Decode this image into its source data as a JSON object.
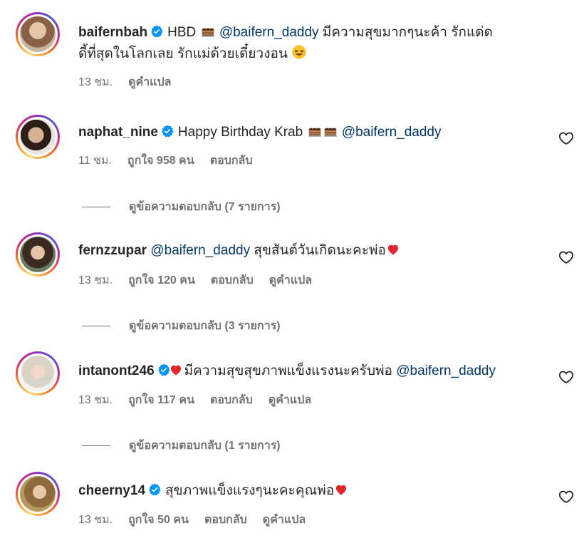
{
  "comments": [
    {
      "username": "baifernbah",
      "verified": true,
      "text_parts": [
        "HBD ",
        "@baifern_daddy",
        " มีความสุขมากๆนะค้า รักแด่ด",
        "ดี้ที่สุดในโลกเลย รักแม่ด้วยเดี๋ยวงอน "
      ],
      "time": "13 ชม.",
      "likes": "",
      "reply": "",
      "translate": "ดูคำแปล",
      "has_heart_button": false,
      "view_replies": ""
    },
    {
      "username": "naphat_nine",
      "verified": true,
      "text_parts": [
        "Happy Birthday Krab ",
        "@baifern_daddy"
      ],
      "time": "11 ชม.",
      "likes": "ถูกใจ 958 คน",
      "reply": "ตอบกลับ",
      "translate": "",
      "has_heart_button": true,
      "view_replies": "ดูข้อความตอบกลับ (7 รายการ)"
    },
    {
      "username": "fernzzupar",
      "verified": false,
      "text_parts": [
        "@baifern_daddy",
        " สุขสันต์วันเกิดนะคะพ่อ"
      ],
      "time": "13 ชม.",
      "likes": "ถูกใจ 120 คน",
      "reply": "ตอบกลับ",
      "translate": "ดูคำแปล",
      "has_heart_button": true,
      "view_replies": "ดูข้อความตอบกลับ (3 รายการ)"
    },
    {
      "username": "intanont246",
      "verified": true,
      "text_parts": [
        "มีความสุขสุขภาพแข็งแรงนะครับพ่อ ",
        "@baifern_daddy"
      ],
      "time": "13 ชม.",
      "likes": "ถูกใจ 117 คน",
      "reply": "ตอบกลับ",
      "translate": "ดูคำแปล",
      "has_heart_button": true,
      "view_replies": "ดูข้อความตอบกลับ (1 รายการ)"
    },
    {
      "username": "cheerny14",
      "verified": true,
      "text_parts": [
        "สุขภาพแข็งแรงๆนะคะคุณพ่อ"
      ],
      "time": "13 ชม.",
      "likes": "ถูกใจ 50 คน",
      "reply": "ตอบกลับ",
      "translate": "ดูคำแปล",
      "has_heart_button": true,
      "view_replies": ""
    }
  ],
  "colors": {
    "text": "#262626",
    "muted": "#737373",
    "mention": "#00376b",
    "verified": "#0095f6",
    "heart": "#ed4956"
  },
  "icons": [
    "verified-badge-icon",
    "cake-emoji-icon",
    "winking-tongue-emoji-icon",
    "red-heart-emoji-icon",
    "heart-outline-icon"
  ]
}
